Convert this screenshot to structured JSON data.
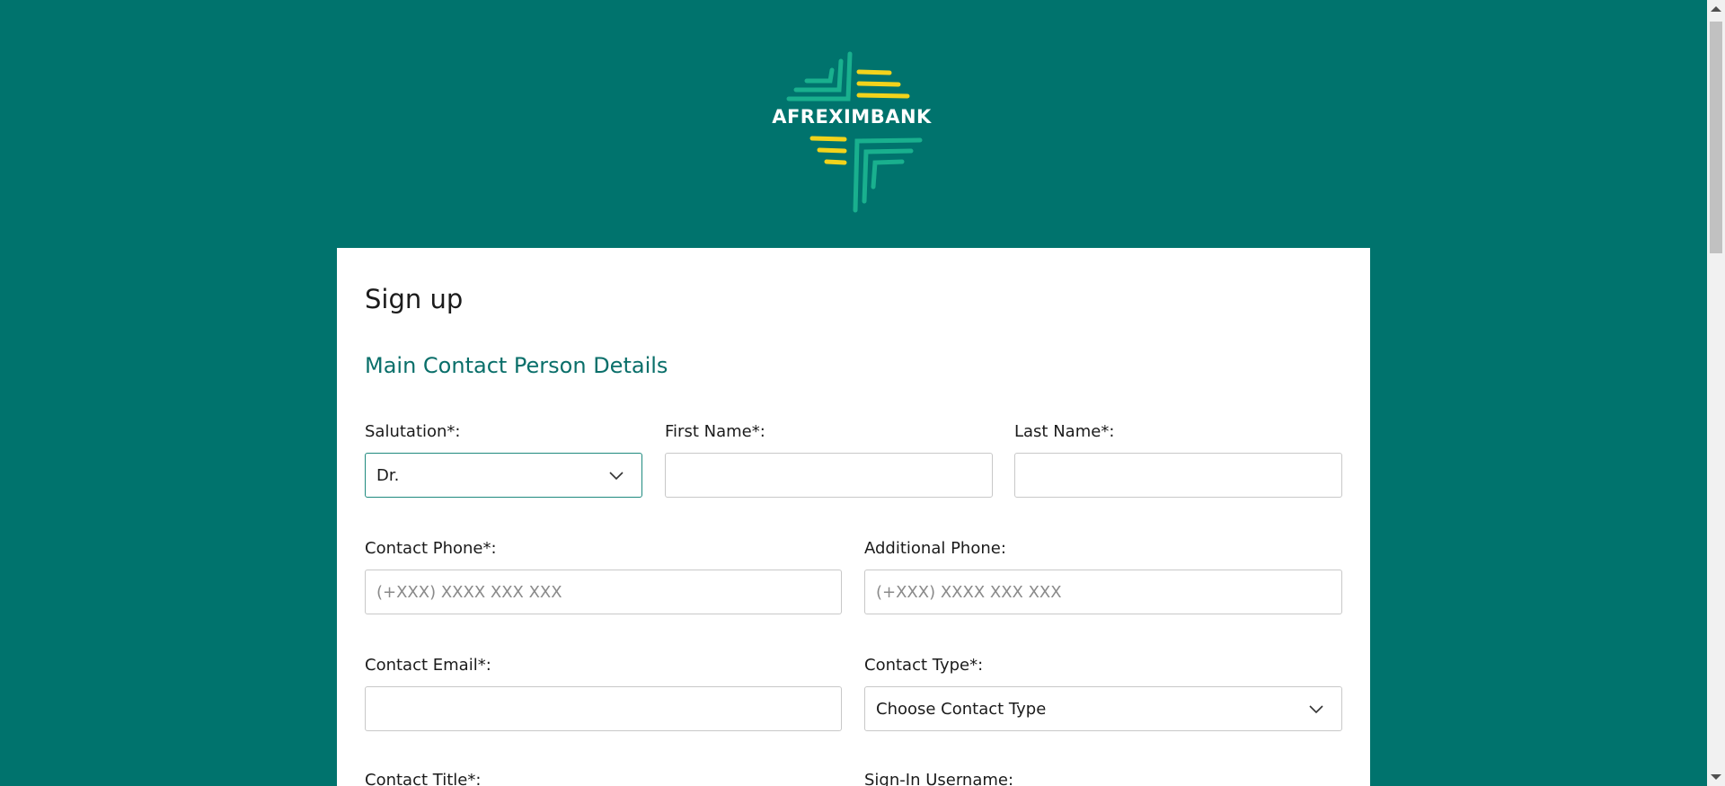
{
  "brand": {
    "name": "AFREXIMBANK"
  },
  "form": {
    "title": "Sign up",
    "section_title": "Main Contact Person Details",
    "fields": {
      "salutation": {
        "label": "Salutation*:",
        "value": "Dr."
      },
      "first_name": {
        "label": "First Name*:",
        "value": ""
      },
      "last_name": {
        "label": "Last Name*:",
        "value": ""
      },
      "contact_phone": {
        "label": "Contact Phone*:",
        "placeholder": "(+XXX) XXXX XXX XXX"
      },
      "additional_phone": {
        "label": "Additional Phone:",
        "placeholder": "(+XXX) XXXX XXX XXX"
      },
      "contact_email": {
        "label": "Contact Email*:",
        "value": ""
      },
      "contact_type": {
        "label": "Contact Type*:",
        "value": "Choose Contact Type"
      },
      "contact_title": {
        "label": "Contact Title*:"
      },
      "signin_username": {
        "label": "Sign-In Username:"
      }
    }
  },
  "colors": {
    "background": "#00736d",
    "accent": "#0a6f6a",
    "logo_green": "#19b08e",
    "logo_yellow": "#f2d31b"
  },
  "icons": {
    "salutation_chevron": "chevron-down-icon",
    "contact_type_chevron": "chevron-down-icon"
  }
}
